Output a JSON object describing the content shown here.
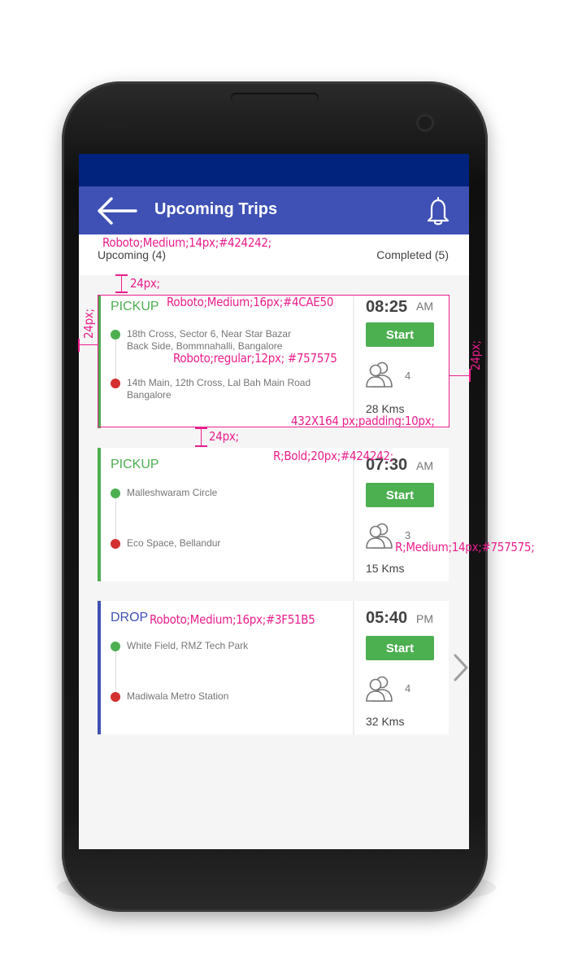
{
  "appbar": {
    "title": "Upcoming Trips"
  },
  "tabs": {
    "upcoming": "Upcoming (4)",
    "completed": "Completed  (5)"
  },
  "trips": [
    {
      "type": "PICKUP",
      "type_color": "#4CAE50",
      "from": [
        "18th Cross, Sector 6, Near Star Bazar",
        "Back Side, Bommnahalli, Bangalore"
      ],
      "to": [
        "14th Main, 12th Cross, Lal Bah Main Road",
        "Bangalore"
      ],
      "time": "08:25",
      "ampm": "AM",
      "start_label": "Start",
      "seats": "4",
      "distance": "28  Kms"
    },
    {
      "type": "PICKUP",
      "type_color": "#4CAE50",
      "from": [
        "Malleshwaram Circle"
      ],
      "to": [
        "Eco Space, Bellandur"
      ],
      "time": "07:30",
      "ampm": "AM",
      "start_label": "Start",
      "seats": "3",
      "distance": "15  Kms"
    },
    {
      "type": "DROP",
      "type_color": "#3F51B5",
      "from": [
        "White Field, RMZ Tech Park"
      ],
      "to": [
        "Madiwala Metro Station"
      ],
      "time": "05:40",
      "ampm": "PM",
      "start_label": "Start",
      "seats": "4",
      "distance": "32  Kms"
    }
  ],
  "annotations": {
    "tab_font": "Roboto;Medium;14px;#424242;",
    "gap_top": "24px;",
    "left_pad": "24px;",
    "type_font": "Roboto;Medium;16px;#4CAE50",
    "address_font": "Roboto;regular;12px; #757575",
    "right_pad": "24px;",
    "card_size": "432X164 px;padding:10px;",
    "gap_between": "24px;",
    "time_font": "R;Bold;20px;#424242;",
    "seats_font": "R;Medium;14px;#757575;",
    "drop_font": "Roboto;Medium;16px;#3F51B5"
  },
  "icons": {
    "back": "arrow-back-icon",
    "bell": "bell-icon",
    "people": "people-icon",
    "next": "chevron-right-icon"
  },
  "colors": {
    "status_bar": "#01237E",
    "app_bar": "#3F51B5",
    "pickup": "#4CAE50",
    "drop": "#3F51B5",
    "start_button": "#4CAF50",
    "annotation": "#E91E8C"
  }
}
